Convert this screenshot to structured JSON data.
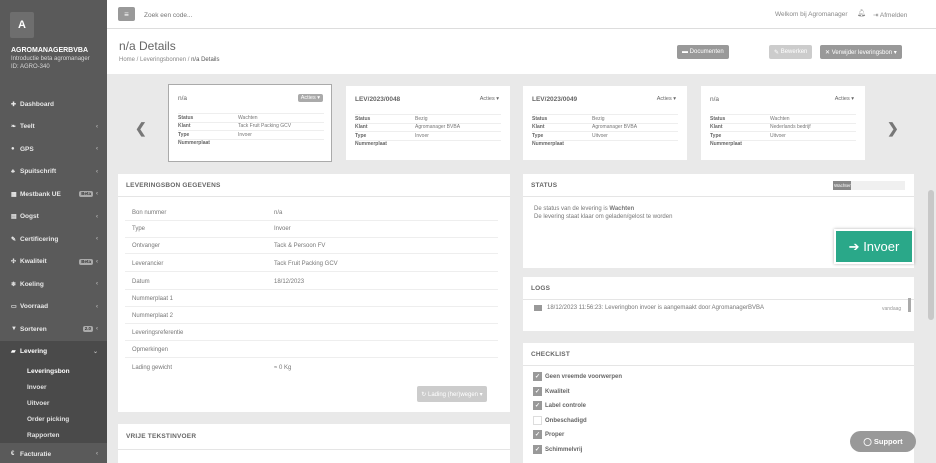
{
  "sidebar": {
    "logo_letter": "A",
    "org_name": "AGROMANAGERBVBA",
    "org_sub1": "Introductie beta agromanager",
    "org_sub2": "ID: AGRO-340",
    "items": [
      {
        "label": "Dashboard",
        "icon": "dashboard-icon",
        "glyph": "✚"
      },
      {
        "label": "Teelt",
        "icon": "leaf-icon",
        "glyph": "❧"
      },
      {
        "label": "GPS",
        "icon": "map-pin-icon",
        "glyph": "●"
      },
      {
        "label": "Spuitschrift",
        "icon": "spray-icon",
        "glyph": "♣"
      },
      {
        "label": "Mestbank UE",
        "icon": "table-icon",
        "glyph": "▦",
        "badge": "Beta"
      },
      {
        "label": "Oogst",
        "icon": "harvest-icon",
        "glyph": "▤"
      },
      {
        "label": "Certificering",
        "icon": "certificate-icon",
        "glyph": "✎"
      },
      {
        "label": "Kwaliteit",
        "icon": "quality-icon",
        "glyph": "✣",
        "badge": "Beta"
      },
      {
        "label": "Koeling",
        "icon": "snowflake-icon",
        "glyph": "❄"
      },
      {
        "label": "Voorraad",
        "icon": "stock-icon",
        "glyph": "▭"
      },
      {
        "label": "Sorteren",
        "icon": "filter-icon",
        "glyph": "▼",
        "badge": "2.0"
      },
      {
        "label": "Levering",
        "icon": "truck-icon",
        "glyph": "▰"
      }
    ],
    "sub_items": [
      "Leveringsbon",
      "Invoer",
      "Uitvoer",
      "Order picking",
      "Rapporten"
    ],
    "bottom_item": "Facturatie"
  },
  "topbar": {
    "menu_glyph": "≡",
    "search_placeholder": "Zoek een code...",
    "welcome": "Welkom bij Agromanager",
    "logout": "Afmelden"
  },
  "header": {
    "title": "n/a Details",
    "breadcrumb": [
      "Home",
      "Leveringsbonnen",
      "n/a Details"
    ],
    "btn_documenten": "Documenten",
    "btn_bewerken": "Bewerken",
    "btn_verwijder": "Verwijder leveringsbon ▾"
  },
  "cards": [
    {
      "title": "n/a",
      "acties": "Acties ▾",
      "rows": [
        [
          "Status",
          "Wachten"
        ],
        [
          "Klant",
          "Tack Fruit Packing GCV"
        ],
        [
          "Type",
          "Invoer"
        ],
        [
          "Nummerplaat",
          ""
        ]
      ]
    },
    {
      "title": "LEV/2023/0048",
      "acties": "Acties ▾",
      "rows": [
        [
          "Status",
          "Bezig"
        ],
        [
          "Klant",
          "Agromanager BVBA"
        ],
        [
          "Type",
          "Invoer"
        ],
        [
          "Nummerplaat",
          ""
        ]
      ]
    },
    {
      "title": "LEV/2023/0049",
      "acties": "Acties ▾",
      "rows": [
        [
          "Status",
          "Bezig"
        ],
        [
          "Klant",
          "Agromanager BVBA"
        ],
        [
          "Type",
          "Uitvoer"
        ],
        [
          "Nummerplaat",
          ""
        ]
      ]
    },
    {
      "title": "n/a",
      "acties": "Acties ▾",
      "rows": [
        [
          "Status",
          "Wachten"
        ],
        [
          "Klant",
          "Nederlands bedrijf"
        ],
        [
          "Type",
          "Uitvoer"
        ],
        [
          "Nummerplaat",
          ""
        ]
      ]
    }
  ],
  "details": {
    "title": "LEVERINGSBON GEGEVENS",
    "rows": [
      [
        "Bon nummer",
        "n/a"
      ],
      [
        "Type",
        "Invoer"
      ],
      [
        "Ontvanger",
        "Tack & Persoon FV"
      ],
      [
        "Leverancier",
        "Tack Fruit Packing GCV"
      ],
      [
        "Datum",
        "18/12/2023"
      ],
      [
        "Nummerplaat 1",
        ""
      ],
      [
        "Nummerplaat 2",
        ""
      ],
      [
        "Leveringsreferentie",
        ""
      ],
      [
        "Opmerkingen",
        ""
      ],
      [
        "Lading gewicht",
        "≈ 0 Kg"
      ]
    ],
    "lading_btn": "Lading (her)wegen ▾"
  },
  "vrije": {
    "title": "VRIJE TEKSTINVOER"
  },
  "status": {
    "title": "STATUS",
    "progress_label": "Wachten",
    "progress_fraction": 0.25,
    "line1_prefix": "De status van de levering is",
    "line1_status": "Wachten",
    "line2": "De levering staat klaar om geladen/gelost te worden"
  },
  "invoer_btn": "Invoer",
  "logs": {
    "title": "LOGS",
    "entry": "18/12/2023 11:56:23: Leveringbon invoer is aangemaakt door AgromanagerBVBA",
    "time": "vandaag"
  },
  "checklist": {
    "title": "CHECKLIST",
    "items": [
      {
        "label": "Geen vreemde voorwerpen",
        "checked": true
      },
      {
        "label": "Kwaliteit",
        "checked": true
      },
      {
        "label": "Label controle",
        "checked": true
      },
      {
        "label": "Onbeschadigd",
        "checked": false
      },
      {
        "label": "Proper",
        "checked": true
      },
      {
        "label": "Schimmelvrij",
        "checked": true
      }
    ]
  },
  "support": "Support",
  "colors": {
    "accent": "#2aa889",
    "sidebar": "#5a5a5a"
  }
}
